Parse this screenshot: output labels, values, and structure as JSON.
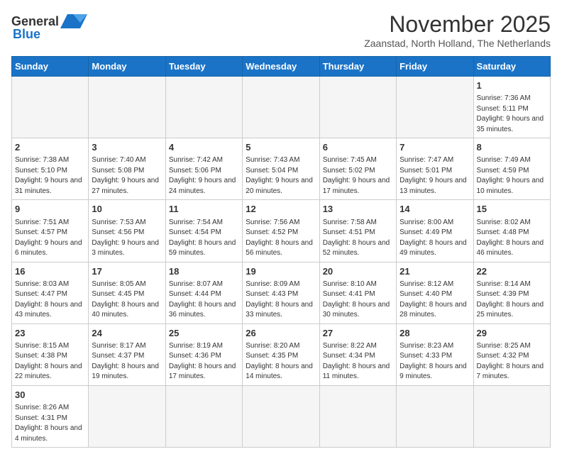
{
  "header": {
    "logo_line1": "General",
    "logo_line2": "Blue",
    "month_title": "November 2025",
    "subtitle": "Zaanstad, North Holland, The Netherlands"
  },
  "days_of_week": [
    "Sunday",
    "Monday",
    "Tuesday",
    "Wednesday",
    "Thursday",
    "Friday",
    "Saturday"
  ],
  "weeks": [
    [
      {
        "day": "",
        "info": ""
      },
      {
        "day": "",
        "info": ""
      },
      {
        "day": "",
        "info": ""
      },
      {
        "day": "",
        "info": ""
      },
      {
        "day": "",
        "info": ""
      },
      {
        "day": "",
        "info": ""
      },
      {
        "day": "1",
        "info": "Sunrise: 7:36 AM\nSunset: 5:11 PM\nDaylight: 9 hours\nand 35 minutes."
      }
    ],
    [
      {
        "day": "2",
        "info": "Sunrise: 7:38 AM\nSunset: 5:10 PM\nDaylight: 9 hours\nand 31 minutes."
      },
      {
        "day": "3",
        "info": "Sunrise: 7:40 AM\nSunset: 5:08 PM\nDaylight: 9 hours\nand 27 minutes."
      },
      {
        "day": "4",
        "info": "Sunrise: 7:42 AM\nSunset: 5:06 PM\nDaylight: 9 hours\nand 24 minutes."
      },
      {
        "day": "5",
        "info": "Sunrise: 7:43 AM\nSunset: 5:04 PM\nDaylight: 9 hours\nand 20 minutes."
      },
      {
        "day": "6",
        "info": "Sunrise: 7:45 AM\nSunset: 5:02 PM\nDaylight: 9 hours\nand 17 minutes."
      },
      {
        "day": "7",
        "info": "Sunrise: 7:47 AM\nSunset: 5:01 PM\nDaylight: 9 hours\nand 13 minutes."
      },
      {
        "day": "8",
        "info": "Sunrise: 7:49 AM\nSunset: 4:59 PM\nDaylight: 9 hours\nand 10 minutes."
      }
    ],
    [
      {
        "day": "9",
        "info": "Sunrise: 7:51 AM\nSunset: 4:57 PM\nDaylight: 9 hours\nand 6 minutes."
      },
      {
        "day": "10",
        "info": "Sunrise: 7:53 AM\nSunset: 4:56 PM\nDaylight: 9 hours\nand 3 minutes."
      },
      {
        "day": "11",
        "info": "Sunrise: 7:54 AM\nSunset: 4:54 PM\nDaylight: 8 hours\nand 59 minutes."
      },
      {
        "day": "12",
        "info": "Sunrise: 7:56 AM\nSunset: 4:52 PM\nDaylight: 8 hours\nand 56 minutes."
      },
      {
        "day": "13",
        "info": "Sunrise: 7:58 AM\nSunset: 4:51 PM\nDaylight: 8 hours\nand 52 minutes."
      },
      {
        "day": "14",
        "info": "Sunrise: 8:00 AM\nSunset: 4:49 PM\nDaylight: 8 hours\nand 49 minutes."
      },
      {
        "day": "15",
        "info": "Sunrise: 8:02 AM\nSunset: 4:48 PM\nDaylight: 8 hours\nand 46 minutes."
      }
    ],
    [
      {
        "day": "16",
        "info": "Sunrise: 8:03 AM\nSunset: 4:47 PM\nDaylight: 8 hours\nand 43 minutes."
      },
      {
        "day": "17",
        "info": "Sunrise: 8:05 AM\nSunset: 4:45 PM\nDaylight: 8 hours\nand 40 minutes."
      },
      {
        "day": "18",
        "info": "Sunrise: 8:07 AM\nSunset: 4:44 PM\nDaylight: 8 hours\nand 36 minutes."
      },
      {
        "day": "19",
        "info": "Sunrise: 8:09 AM\nSunset: 4:43 PM\nDaylight: 8 hours\nand 33 minutes."
      },
      {
        "day": "20",
        "info": "Sunrise: 8:10 AM\nSunset: 4:41 PM\nDaylight: 8 hours\nand 30 minutes."
      },
      {
        "day": "21",
        "info": "Sunrise: 8:12 AM\nSunset: 4:40 PM\nDaylight: 8 hours\nand 28 minutes."
      },
      {
        "day": "22",
        "info": "Sunrise: 8:14 AM\nSunset: 4:39 PM\nDaylight: 8 hours\nand 25 minutes."
      }
    ],
    [
      {
        "day": "23",
        "info": "Sunrise: 8:15 AM\nSunset: 4:38 PM\nDaylight: 8 hours\nand 22 minutes."
      },
      {
        "day": "24",
        "info": "Sunrise: 8:17 AM\nSunset: 4:37 PM\nDaylight: 8 hours\nand 19 minutes."
      },
      {
        "day": "25",
        "info": "Sunrise: 8:19 AM\nSunset: 4:36 PM\nDaylight: 8 hours\nand 17 minutes."
      },
      {
        "day": "26",
        "info": "Sunrise: 8:20 AM\nSunset: 4:35 PM\nDaylight: 8 hours\nand 14 minutes."
      },
      {
        "day": "27",
        "info": "Sunrise: 8:22 AM\nSunset: 4:34 PM\nDaylight: 8 hours\nand 11 minutes."
      },
      {
        "day": "28",
        "info": "Sunrise: 8:23 AM\nSunset: 4:33 PM\nDaylight: 8 hours\nand 9 minutes."
      },
      {
        "day": "29",
        "info": "Sunrise: 8:25 AM\nSunset: 4:32 PM\nDaylight: 8 hours\nand 7 minutes."
      }
    ],
    [
      {
        "day": "30",
        "info": "Sunrise: 8:26 AM\nSunset: 4:31 PM\nDaylight: 8 hours\nand 4 minutes."
      },
      {
        "day": "",
        "info": ""
      },
      {
        "day": "",
        "info": ""
      },
      {
        "day": "",
        "info": ""
      },
      {
        "day": "",
        "info": ""
      },
      {
        "day": "",
        "info": ""
      },
      {
        "day": "",
        "info": ""
      }
    ]
  ]
}
